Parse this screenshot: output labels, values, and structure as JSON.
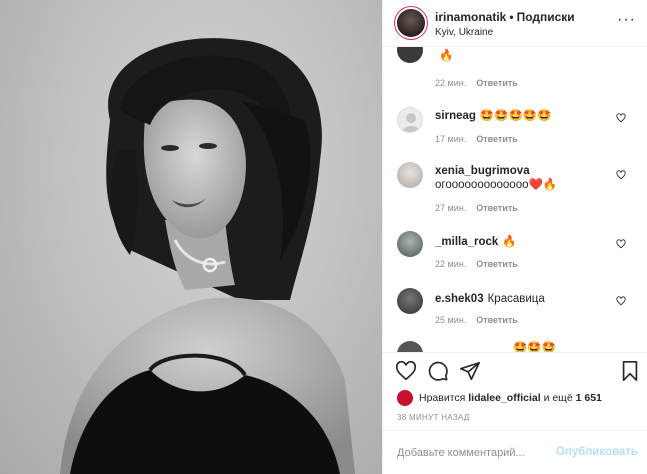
{
  "header": {
    "username": "irinamonatik",
    "dot": "•",
    "follow_label": "Подписки",
    "location": "Kyiv, Ukraine",
    "more_label": "···"
  },
  "comments": [
    {
      "user": "",
      "text": "🔥",
      "time": "22 мин.",
      "reply": "Ответить",
      "avatar_color": "#3a3a3a"
    },
    {
      "user": "sirneag",
      "text": "🤩🤩🤩🤩🤩",
      "time": "17 мин.",
      "reply": "Ответить",
      "avatar_color": "#e8e8e8"
    },
    {
      "user": "xenia_bugrimova",
      "text": "огооооооооооооо❤️🔥",
      "time": "27 мин.",
      "reply": "Ответить",
      "avatar_color": "#cfc9c4"
    },
    {
      "user": "_milla_rock",
      "text": "🔥",
      "time": "22 мин.",
      "reply": "Ответить",
      "avatar_color": "#7a8a86"
    },
    {
      "user": "e.shek03",
      "text": "Красавица",
      "time": "25 мин.",
      "reply": "Ответить",
      "avatar_color": "#4d514e"
    },
    {
      "user": "",
      "text": "🤩🤩🤩",
      "time": "",
      "reply": "",
      "avatar_color": "#555555"
    }
  ],
  "likes": {
    "prefix": "Нравится",
    "user": "lidalee_official",
    "middle": "и ещё",
    "count": "1 651"
  },
  "timestamp": "38 МИНУТ НАЗАД",
  "add_comment": {
    "placeholder": "Добавьте комментарий...",
    "publish_label": "Опубликовать"
  },
  "icons": [
    "heart-icon",
    "comment-icon",
    "share-icon",
    "bookmark-icon",
    "smile-icon"
  ],
  "colors": {
    "border": "#efefef",
    "muted": "#8e8e8e",
    "publish_disabled": "#b2dffc",
    "story_ring": "#d62976"
  }
}
